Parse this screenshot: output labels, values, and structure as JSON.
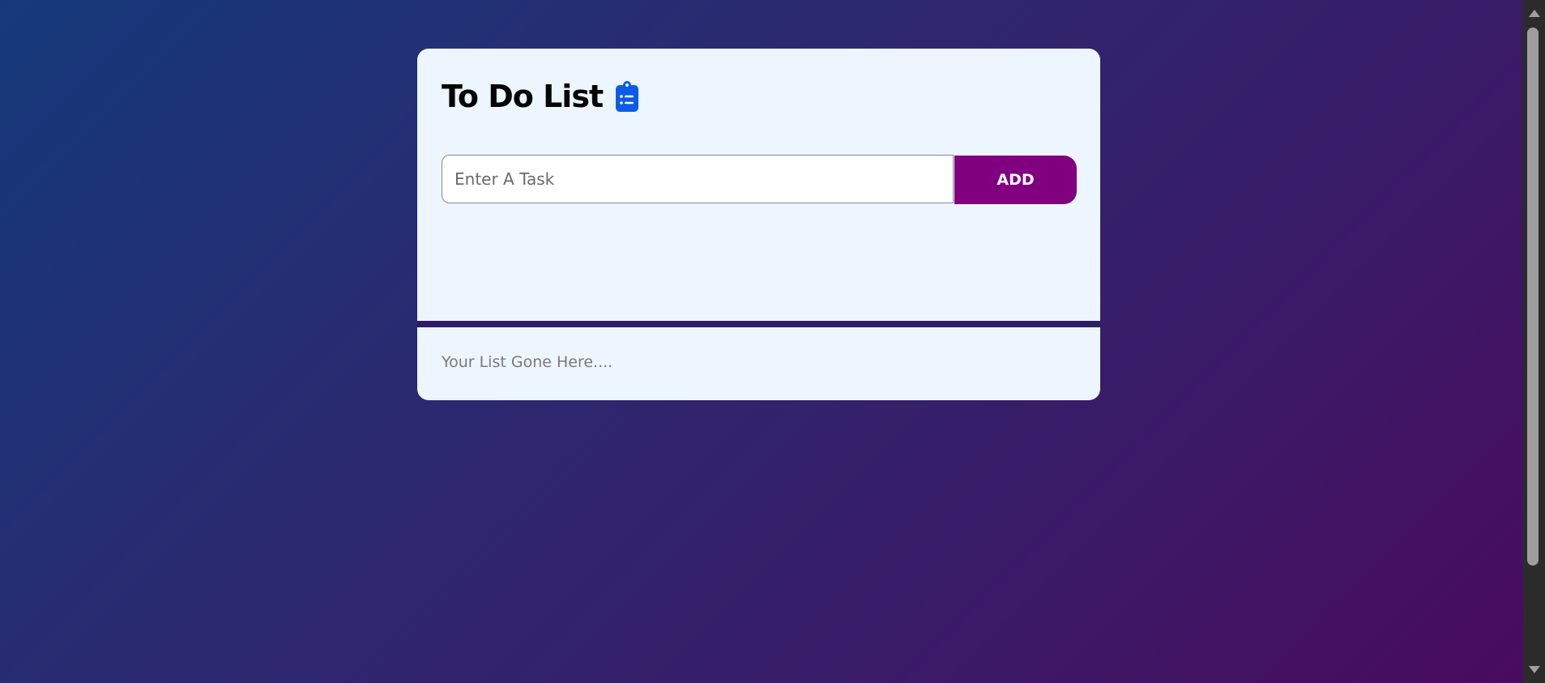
{
  "app": {
    "title": "To Do List"
  },
  "task_entry": {
    "placeholder": "Enter A Task",
    "value": "",
    "add_label": "ADD"
  },
  "list": {
    "empty_text": "Your List Gone Here...."
  },
  "icons": {
    "title_icon": "clipboard-list-icon"
  },
  "colors": {
    "card_background": "#edf5fe",
    "add_button": "#800080",
    "icon_blue": "#0d5ce8",
    "background_start": "#153a7c",
    "background_end": "#4a0a5e"
  }
}
